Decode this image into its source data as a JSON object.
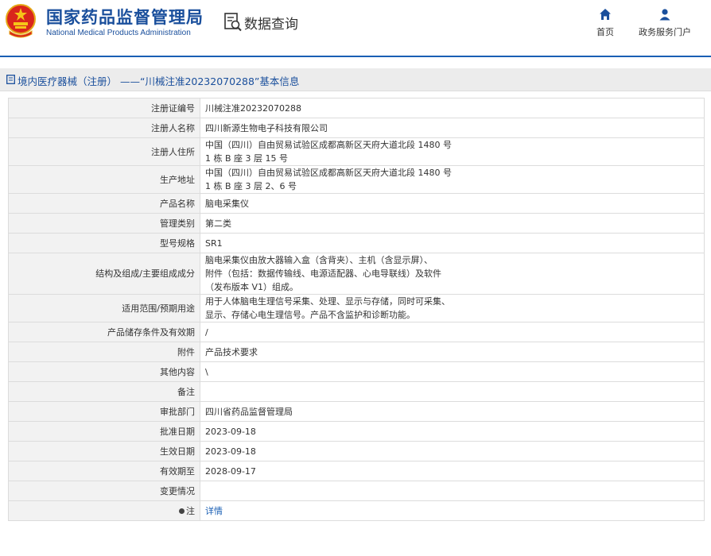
{
  "header": {
    "org_cn": "国家药品监督管理局",
    "org_en": "National Medical Products Administration",
    "query_label": "数据查询",
    "nav": [
      {
        "label": "首页",
        "icon": "home-icon"
      },
      {
        "label": "政务服务门户",
        "icon": "user-icon"
      }
    ]
  },
  "titlebar": {
    "text": "境内医疗器械（注册） ——“川械注准20232070288”基本信息"
  },
  "table": {
    "rows": [
      {
        "label": "注册证编号",
        "value": "川械注准20232070288"
      },
      {
        "label": "注册人名称",
        "value": "四川新源生物电子科技有限公司"
      },
      {
        "label": "注册人住所",
        "lines": [
          "中国（四川）自由贸易试验区成都高新区天府大道北段 1480 号",
          "1 栋 B 座 3 层 15 号"
        ]
      },
      {
        "label": "生产地址",
        "lines": [
          "中国（四川）自由贸易试验区成都高新区天府大道北段 1480 号",
          "1 栋 B 座 3 层 2、6 号"
        ]
      },
      {
        "label": "产品名称",
        "value": "脑电采集仪"
      },
      {
        "label": "管理类别",
        "value": "第二类"
      },
      {
        "label": "型号规格",
        "value": "SR1"
      },
      {
        "label": "结构及组成/主要组成成分",
        "lines": [
          "脑电采集仪由放大器输入盒（含背夹）、主机（含显示屏）、",
          "附件（包括：数据传输线、电源适配器、心电导联线）及软件",
          "（发布版本 V1）组成。"
        ]
      },
      {
        "label": "适用范围/预期用途",
        "lines": [
          "用于人体脑电生理信号采集、处理、显示与存储，同时可采集、",
          "显示、存储心电生理信号。产品不含监护和诊断功能。"
        ]
      },
      {
        "label": "产品储存条件及有效期",
        "value": "/"
      },
      {
        "label": "附件",
        "value": "产品技术要求"
      },
      {
        "label": "其他内容",
        "value": "\\"
      },
      {
        "label": "备注",
        "value": ""
      },
      {
        "label": "审批部门",
        "value": "四川省药品监督管理局"
      },
      {
        "label": "批准日期",
        "value": "2023-09-18"
      },
      {
        "label": "生效日期",
        "value": "2023-09-18"
      },
      {
        "label": "有效期至",
        "value": "2028-09-17"
      },
      {
        "label": "变更情况",
        "value": ""
      },
      {
        "label": "注",
        "value": "详情"
      }
    ]
  }
}
